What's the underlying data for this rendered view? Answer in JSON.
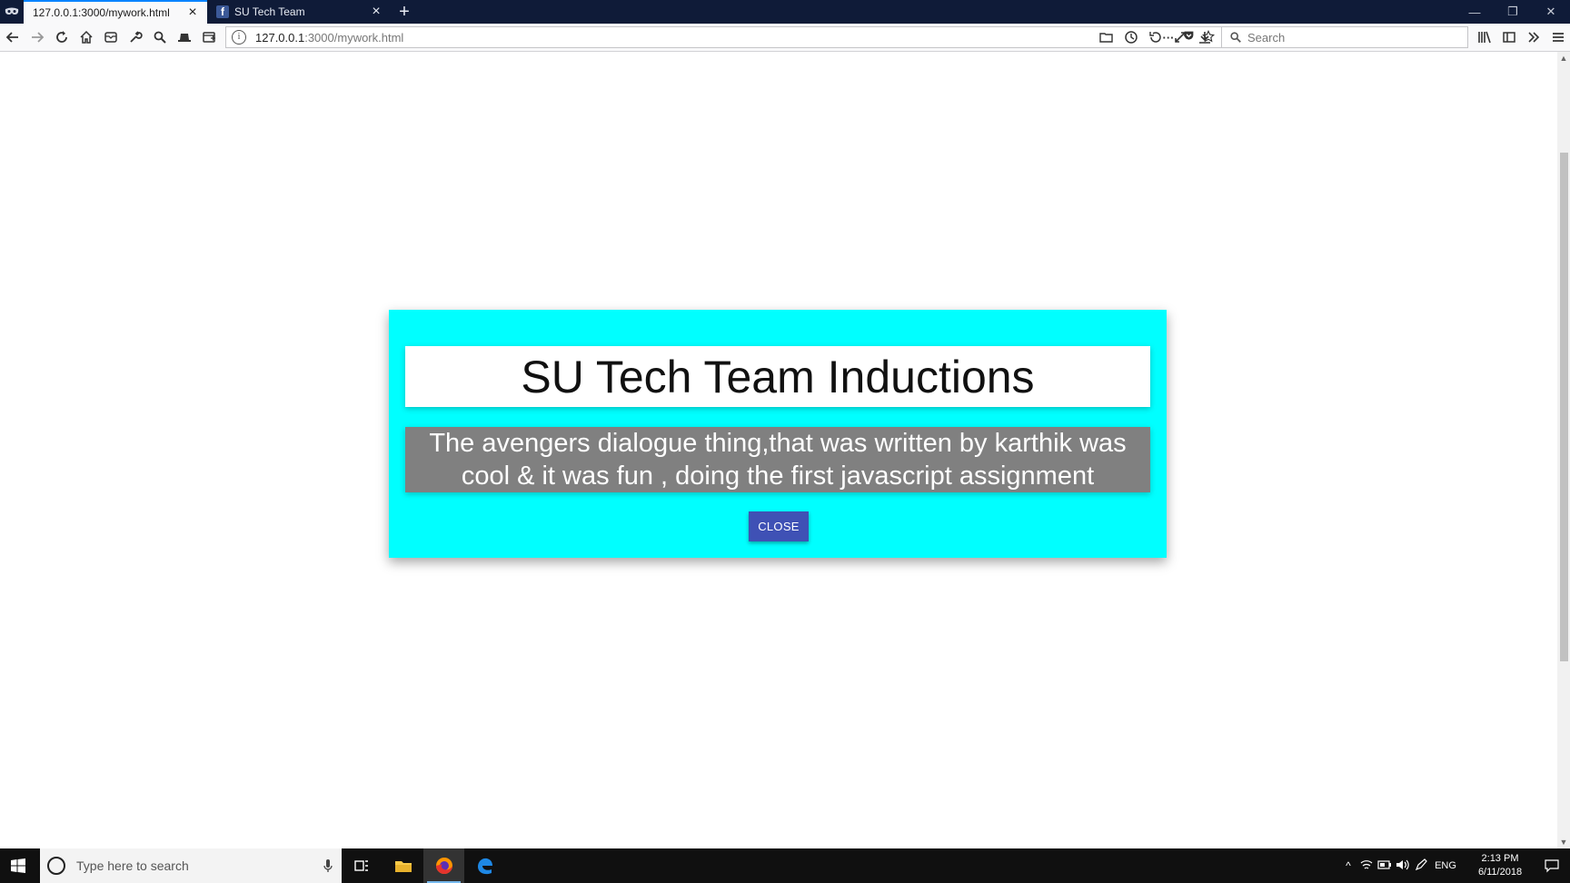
{
  "browser": {
    "tabs": [
      {
        "title": "127.0.0.1:3000/mywork.html",
        "active": true
      },
      {
        "title": "SU Tech Team",
        "active": false
      }
    ],
    "url": "127.0.0.1:3000/mywork.html",
    "url_host": "127.0.0.1",
    "url_rest": ":3000/mywork.html",
    "search_placeholder": "Search",
    "tab_close_glyph": "×",
    "new_tab_glyph": "+",
    "page_actions_glyph": "···",
    "icons": {
      "private": "private-browsing-mask-icon",
      "back": "back-arrow-icon",
      "forward": "forward-arrow-icon",
      "reload": "reload-icon",
      "home": "home-icon",
      "mail": "mail-icon",
      "tools": "wrench-icon",
      "search": "magnifier-icon",
      "hat": "hat-icon",
      "screenshot": "screenshot-icon",
      "pocket": "pocket-icon",
      "bookmark": "star-icon",
      "library": "library-icon",
      "sidebar": "sidebar-icon",
      "overflow": "double-chevron-icon",
      "menu": "hamburger-menu-icon"
    }
  },
  "modal": {
    "title": "SU Tech Team Inductions",
    "message": "The avengers dialogue thing,that was written by karthik was cool & it was fun , doing the first javascript assignment",
    "close_label": "CLOSE",
    "colors": {
      "background": "#00ffff",
      "title_bg": "#ffffff",
      "message_bg": "#808080",
      "button": "#3f51b5"
    }
  },
  "taskbar": {
    "search_placeholder": "Type here to search",
    "language": "ENG",
    "time": "2:13 PM",
    "date": "6/11/2018",
    "apps": [
      "task-view",
      "file-explorer",
      "firefox",
      "edge"
    ]
  }
}
